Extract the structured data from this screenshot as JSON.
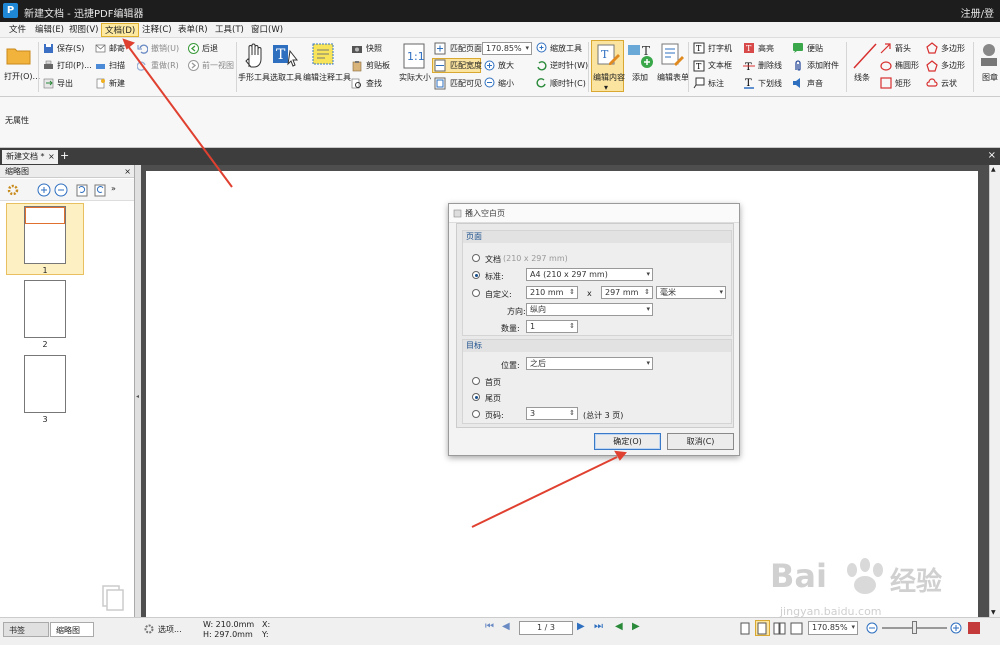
{
  "titlebar": {
    "title": "新建文档 - 迅捷PDF编辑器",
    "user": "注册/登"
  },
  "menu": [
    "文件",
    "编辑(E)",
    "视图(V)",
    "文档(D)",
    "注释(C)",
    "表单(R)",
    "工具(T)",
    "窗口(W)"
  ],
  "ribbon": {
    "open": "打开(O)...",
    "save": "保存(S)",
    "print": "打印(P)...",
    "export": "导出",
    "mail": "邮寄",
    "scan": "扫描",
    "new": "新建",
    "undo": "撤销(U)",
    "redo": "重做(R)",
    "back": "后退",
    "forward": "前一视图",
    "hand": "手形工具",
    "select_text": "选取工具",
    "edit_annot": "编辑注释工具",
    "snapshot": "快照",
    "clipboard": "剪贴板",
    "find": "查找",
    "actual_size": "实际大小",
    "fit_page": "匹配页面",
    "fit_width": "匹配宽度",
    "fit_visible": "匹配可见",
    "zoom_value": "170.85%",
    "zoom_tool": "缩放工具",
    "zoom_in": "放大",
    "zoom_out": "缩小",
    "rotate_ccw": "逆时针(W)",
    "rotate_cw": "顺时针(C)",
    "edit_content": "编辑内容",
    "add": "添加",
    "edit_form": "编辑表单",
    "typewriter": "打字机",
    "textbox": "文本框",
    "callout": "标注",
    "highlight": "高亮",
    "strikeout": "删除线",
    "underline": "下划线",
    "note": "便贴",
    "attach": "添加附件",
    "sound": "声音",
    "line": "线条",
    "arrow": "箭头",
    "ellipse": "椭圆形",
    "rect": "矩形",
    "polygon": "多边形",
    "polyline": "多边形",
    "cloud": "云状",
    "stamp": "图章"
  },
  "props": {
    "label": "无属性"
  },
  "tabs": {
    "doc_tab": "新建文档 *"
  },
  "leftpanel": {
    "title": "缩略图",
    "pages": [
      "1",
      "2",
      "3"
    ],
    "bottom_tabs": [
      "书签",
      "缩略图"
    ]
  },
  "dialog": {
    "title": "插入空白页",
    "page_group": "页面",
    "doc_label": "文档",
    "doc_size": "(210 x 297 mm)",
    "std_label": "标准:",
    "std_value": "A4 (210 x 297 mm)",
    "custom_label": "自定义:",
    "width_value": "210 mm",
    "times": "x",
    "height_value": "297 mm",
    "unit_value": "毫米",
    "orient_label": "方向:",
    "orient_value": "纵向",
    "count_label": "数量:",
    "count_value": "1",
    "target_group": "目标",
    "pos_label": "位置:",
    "pos_value": "之后",
    "first_label": "首页",
    "last_label": "尾页",
    "pagenum_label": "页码:",
    "pagenum_value": "3",
    "total_text": "(总计 3 页)",
    "ok": "确定(O)",
    "cancel": "取消(C)"
  },
  "status": {
    "options": "选项...",
    "w": "W: 210.0mm",
    "h": "H: 297.0mm",
    "x": "X:",
    "y": "Y:",
    "page": "1 / 3",
    "zoom": "170.85%"
  },
  "watermark": {
    "brand": "Bai",
    "brand_cn": "经验",
    "url": "jingyan.baidu.com"
  },
  "colors": {
    "titlebar": "#1d1d1d",
    "accent": "#1e88d6",
    "active_menu": "#fdeaa0",
    "arrow_red": "#e04030"
  }
}
